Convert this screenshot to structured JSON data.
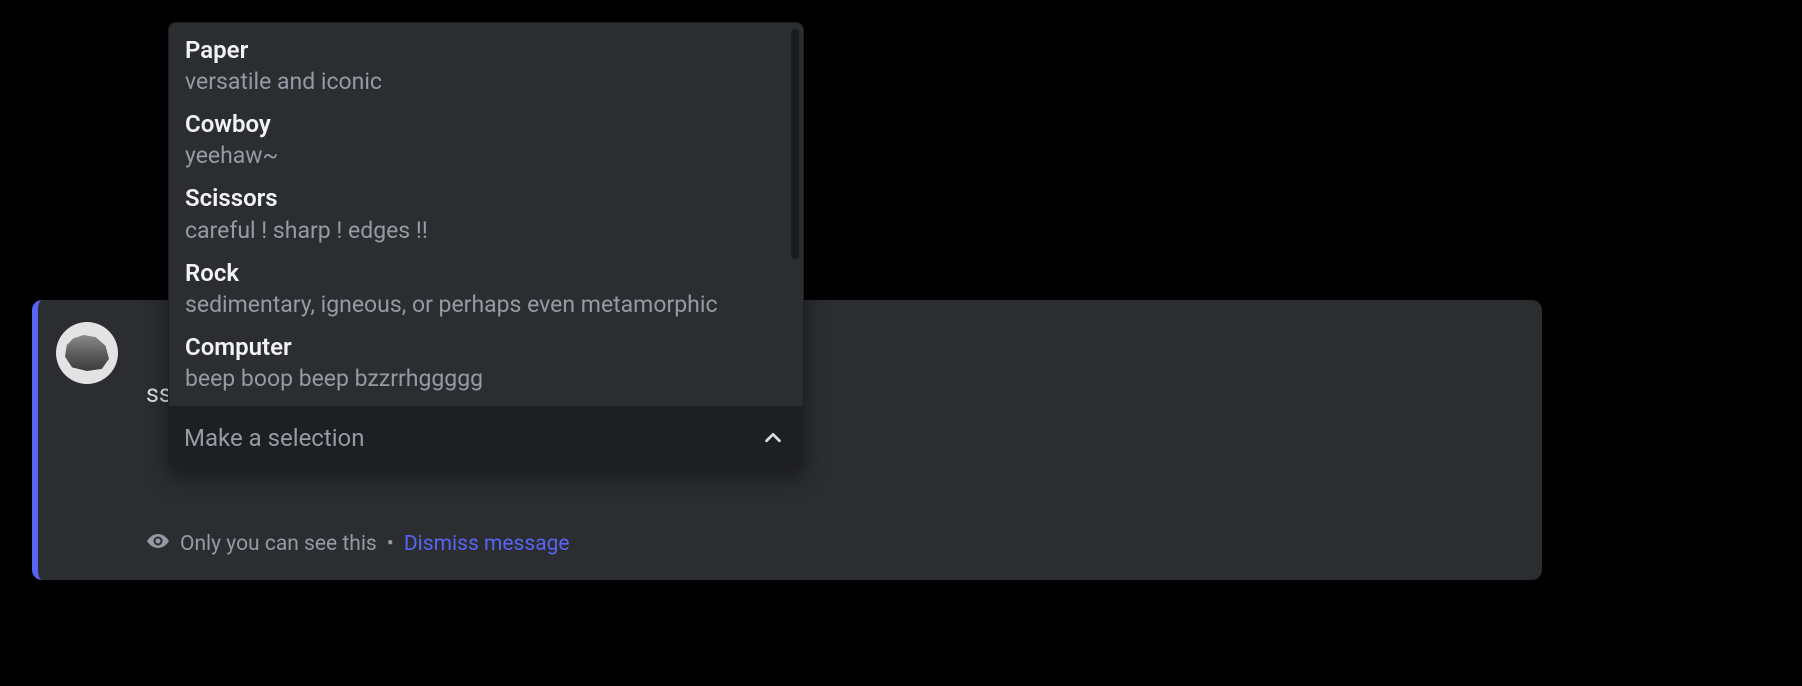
{
  "message": {
    "challenge_text_visible": "ssors challenge:",
    "ephemeral_prefix": "Only you can see this",
    "ephemeral_separator": "•",
    "dismiss_label": "Dismiss message"
  },
  "select": {
    "placeholder": "Make a selection",
    "options": [
      {
        "label": "Paper",
        "description": "versatile and iconic"
      },
      {
        "label": "Cowboy",
        "description": "yeehaw~"
      },
      {
        "label": "Scissors",
        "description": "careful ! sharp ! edges !!"
      },
      {
        "label": "Rock",
        "description": "sedimentary, igneous, or perhaps even metamorphic"
      },
      {
        "label": "Computer",
        "description": "beep boop beep bzzrrhggggg"
      }
    ]
  }
}
